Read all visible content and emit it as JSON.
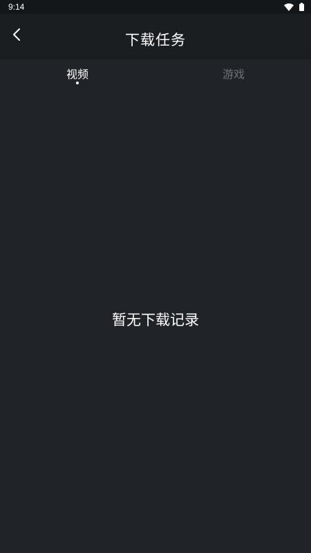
{
  "status_bar": {
    "time": "9:14",
    "icons": [
      "wifi-icon",
      "battery-icon"
    ]
  },
  "header": {
    "back_icon": "chevron-left-icon",
    "title": "下载任务"
  },
  "tabs": [
    {
      "label": "视频",
      "selected": true
    },
    {
      "label": "游戏",
      "selected": false
    }
  ],
  "content": {
    "empty_message": "暂无下载记录"
  },
  "colors": {
    "background": "#202428",
    "header_background": "#1b1e21",
    "status_bar_background": "#14171a",
    "active_tab": "#ffffff",
    "inactive_tab": "#6f7378"
  }
}
